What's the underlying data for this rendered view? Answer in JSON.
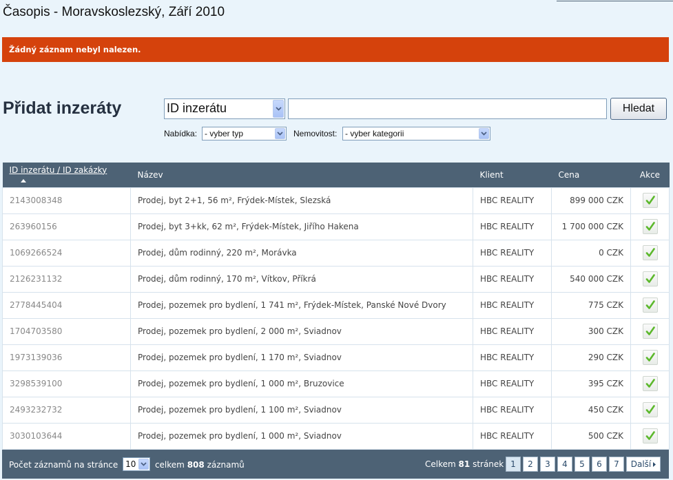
{
  "header": {
    "title": "Časopis - Moravskoslezský, Září 2010"
  },
  "alert": {
    "message": "Žádný záznam nebyl nalezen."
  },
  "search": {
    "title": "Přidat inzeráty",
    "field_select": "ID inzerátu",
    "query": "",
    "button": "Hledat",
    "offer_label": "Nabídka:",
    "offer_select": "- vyber typ",
    "property_label": "Nemovitost:",
    "property_select": "- vyber kategorii"
  },
  "table": {
    "columns": [
      "ID inzerátu / ID zakázky",
      "Název",
      "Klient",
      "Cena",
      "Akce"
    ],
    "rows": [
      {
        "id": "2143008348",
        "name": "Prodej, byt 2+1, 56 m², Frýdek-Místek, Slezská",
        "client": "HBC REALITY",
        "price": "899 000 CZK"
      },
      {
        "id": "263960156",
        "name": "Prodej, byt 3+kk, 62 m², Frýdek-Místek, Jiřího Hakena",
        "client": "HBC REALITY",
        "price": "1 700 000 CZK"
      },
      {
        "id": "1069266524",
        "name": "Prodej, dům rodinný, 220 m², Morávka",
        "client": "HBC REALITY",
        "price": "0 CZK"
      },
      {
        "id": "2126231132",
        "name": "Prodej, dům rodinný, 170 m², Vítkov, Příkrá",
        "client": "HBC REALITY",
        "price": "540 000 CZK"
      },
      {
        "id": "2778445404",
        "name": "Prodej, pozemek pro bydlení, 1 741 m², Frýdek-Místek, Panské Nové Dvory",
        "client": "HBC REALITY",
        "price": "775 CZK"
      },
      {
        "id": "1704703580",
        "name": "Prodej, pozemek pro bydlení, 2 000 m², Sviadnov",
        "client": "HBC REALITY",
        "price": "300 CZK"
      },
      {
        "id": "1973139036",
        "name": "Prodej, pozemek pro bydlení, 1 170 m², Sviadnov",
        "client": "HBC REALITY",
        "price": "290 CZK"
      },
      {
        "id": "3298539100",
        "name": "Prodej, pozemek pro bydlení, 1 000 m², Bruzovice",
        "client": "HBC REALITY",
        "price": "395 CZK"
      },
      {
        "id": "2493232732",
        "name": "Prodej, pozemek pro bydlení, 1 100 m², Sviadnov",
        "client": "HBC REALITY",
        "price": "450 CZK"
      },
      {
        "id": "3030103644",
        "name": "Prodej, pozemek pro bydlení, 1 000 m², Sviadnov",
        "client": "HBC REALITY",
        "price": "500 CZK"
      }
    ]
  },
  "footer": {
    "per_page_label": "Počet záznamů na stránce",
    "per_page_value": "10",
    "total_prefix": "celkem",
    "total_count": "808",
    "total_suffix": "záznamů",
    "pages_prefix": "Celkem",
    "pages_count": "81",
    "pages_suffix": "stránek",
    "pages": [
      "1",
      "2",
      "3",
      "4",
      "5",
      "6",
      "7"
    ],
    "next": "Další"
  },
  "chart_data": {
    "type": "table",
    "columns": [
      "ID inzerátu / ID zakázky",
      "Název",
      "Klient",
      "Cena",
      "Akce"
    ],
    "rows": [
      [
        "2143008348",
        "Prodej, byt 2+1, 56 m², Frýdek-Místek, Slezská",
        "HBC REALITY",
        "899 000 CZK"
      ],
      [
        "263960156",
        "Prodej, byt 3+kk, 62 m², Frýdek-Místek, Jiřího Hakena",
        "HBC REALITY",
        "1 700 000 CZK"
      ],
      [
        "1069266524",
        "Prodej, dům rodinný, 220 m², Morávka",
        "HBC REALITY",
        "0 CZK"
      ],
      [
        "2126231132",
        "Prodej, dům rodinný, 170 m², Vítkov, Příkrá",
        "HBC REALITY",
        "540 000 CZK"
      ],
      [
        "2778445404",
        "Prodej, pozemek pro bydlení, 1 741 m², Frýdek-Místek, Panské Nové Dvory",
        "HBC REALITY",
        "775 CZK"
      ],
      [
        "1704703580",
        "Prodej, pozemek pro bydlení, 2 000 m², Sviadnov",
        "HBC REALITY",
        "300 CZK"
      ],
      [
        "1973139036",
        "Prodej, pozemek pro bydlení, 1 170 m², Sviadnov",
        "HBC REALITY",
        "290 CZK"
      ],
      [
        "3298539100",
        "Prodej, pozemek pro bydlení, 1 000 m², Bruzovice",
        "HBC REALITY",
        "395 CZK"
      ],
      [
        "2493232732",
        "Prodej, pozemek pro bydlení, 1 100 m², Sviadnov",
        "HBC REALITY",
        "450 CZK"
      ],
      [
        "3030103644",
        "Prodej, pozemek pro bydlení, 1 000 m², Sviadnov",
        "HBC REALITY",
        "500 CZK"
      ]
    ]
  },
  "colors": {
    "alert_bg": "#d5420c",
    "table_header_bg": "#4d6275",
    "page_bg": "#eaf4fb",
    "check_green": "#5cb82c"
  },
  "icons": {
    "sort": "sort-asc-icon",
    "check": "check-icon",
    "dropdown": "chevron-down-icon",
    "next": "chevron-right-icon"
  }
}
